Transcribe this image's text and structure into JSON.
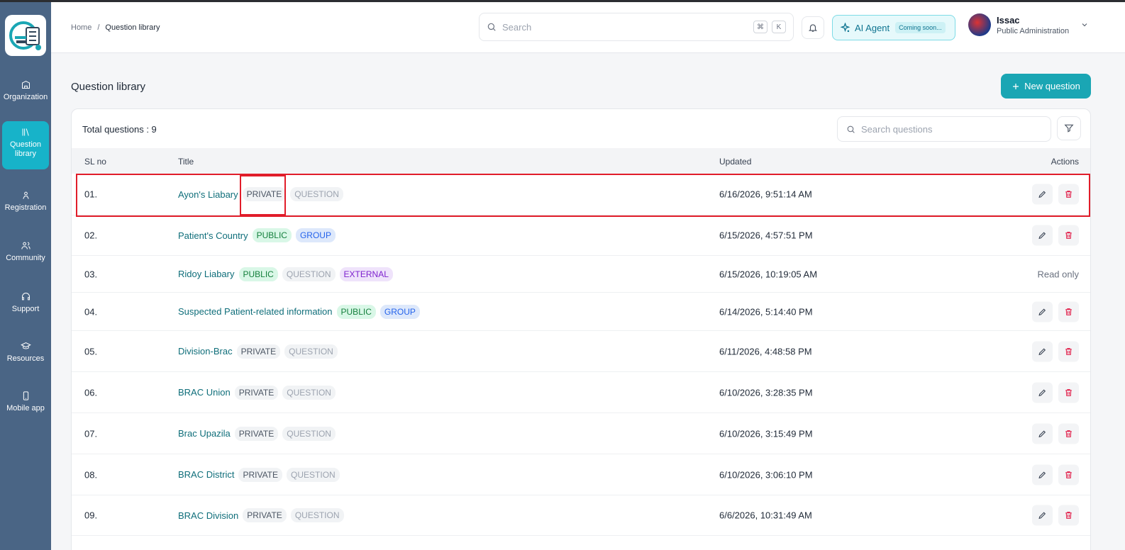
{
  "app": {
    "logo_name": "app-logo"
  },
  "sidebar": {
    "items": [
      {
        "label": "Organization",
        "icon": "building-icon"
      },
      {
        "label": "Question library",
        "icon": "library-icon",
        "active": true
      },
      {
        "label": "Registration",
        "icon": "registration-icon"
      },
      {
        "label": "Community",
        "icon": "community-icon"
      },
      {
        "label": "Support",
        "icon": "headset-icon"
      },
      {
        "label": "Resources",
        "icon": "graduation-cap-icon"
      },
      {
        "label": "Mobile app",
        "icon": "mobile-icon"
      }
    ]
  },
  "header": {
    "breadcrumb": {
      "home": "Home",
      "separator": "/",
      "current": "Question library"
    },
    "search": {
      "placeholder": "Search",
      "shortcut_cmd": "⌘",
      "shortcut_key": "K"
    },
    "ai_agent": {
      "label": "AI Agent",
      "badge": "Coming soon..."
    },
    "user": {
      "name": "Issac",
      "org": "Public Administration"
    }
  },
  "page": {
    "title": "Question library",
    "new_button": "New question",
    "total_label": "Total questions : 9",
    "search_placeholder": "Search questions"
  },
  "table": {
    "columns": {
      "sl": "SL no",
      "title": "Title",
      "updated": "Updated",
      "actions": "Actions"
    },
    "rows": [
      {
        "sl": "01.",
        "title": "Ayon's Liabary",
        "badges": [
          "PRIVATE",
          "QUESTION"
        ],
        "updated": "6/16/2026, 9:51:14 AM",
        "actions": "edit-delete"
      },
      {
        "sl": "02.",
        "title": "Patient's Country",
        "badges": [
          "PUBLIC",
          "GROUP"
        ],
        "updated": "6/15/2026, 4:57:51 PM",
        "actions": "edit-delete"
      },
      {
        "sl": "03.",
        "title": "Ridoy Liabary",
        "badges": [
          "PUBLIC",
          "QUESTION",
          "EXTERNAL"
        ],
        "updated": "6/15/2026, 10:19:05 AM",
        "actions": "Read only"
      },
      {
        "sl": "04.",
        "title": "Suspected Patient-related information",
        "badges": [
          "PUBLIC",
          "GROUP"
        ],
        "updated": "6/14/2026, 5:14:40 PM",
        "actions": "edit-delete"
      },
      {
        "sl": "05.",
        "title": "Division-Brac",
        "badges": [
          "PRIVATE",
          "QUESTION"
        ],
        "updated": "6/11/2026, 4:48:58 PM",
        "actions": "edit-delete"
      },
      {
        "sl": "06.",
        "title": "BRAC Union",
        "badges": [
          "PRIVATE",
          "QUESTION"
        ],
        "updated": "6/10/2026, 3:28:35 PM",
        "actions": "edit-delete"
      },
      {
        "sl": "07.",
        "title": "Brac Upazila",
        "badges": [
          "PRIVATE",
          "QUESTION"
        ],
        "updated": "6/10/2026, 3:15:49 PM",
        "actions": "edit-delete"
      },
      {
        "sl": "08.",
        "title": "BRAC District",
        "badges": [
          "PRIVATE",
          "QUESTION"
        ],
        "updated": "6/10/2026, 3:06:10 PM",
        "actions": "edit-delete"
      },
      {
        "sl": "09.",
        "title": "BRAC Division",
        "badges": [
          "PRIVATE",
          "QUESTION"
        ],
        "updated": "6/6/2026, 10:31:49 AM",
        "actions": "edit-delete"
      }
    ]
  },
  "colors": {
    "sidebar": "#4a6585",
    "accent": "#1aa6b4",
    "active_nav": "#17b3c9",
    "highlight": "#e11d2a"
  }
}
